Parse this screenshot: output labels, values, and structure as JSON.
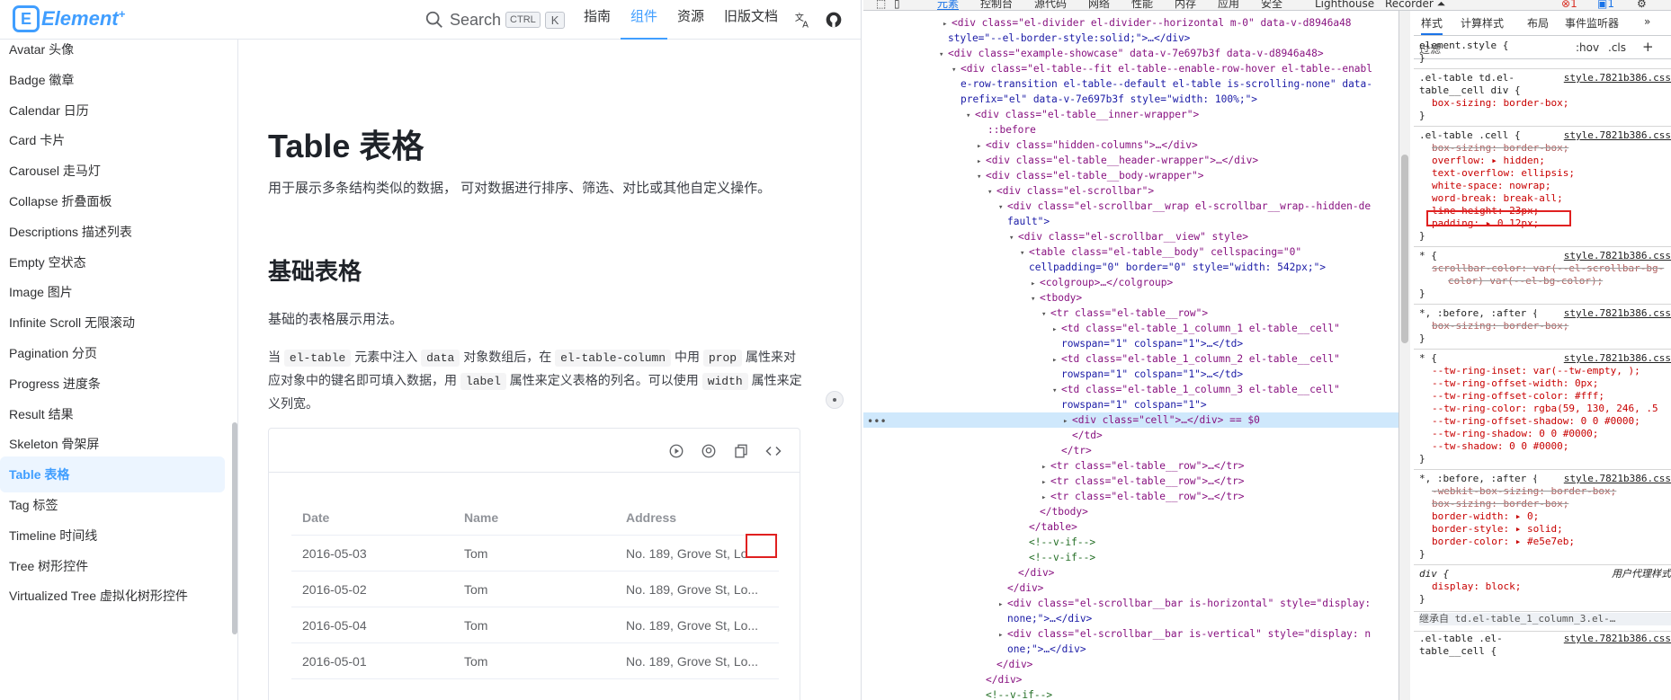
{
  "site": {
    "logo": "Element",
    "logo_plus": "+",
    "search": {
      "placeholder": "Search",
      "kbd_ctrl": "CTRL",
      "kbd_k": "K"
    },
    "nav": [
      "指南",
      "组件",
      "资源",
      "旧版文档"
    ],
    "sidebar": [
      "Avatar 头像",
      "Badge 徽章",
      "Calendar 日历",
      "Card 卡片",
      "Carousel 走马灯",
      "Collapse 折叠面板",
      "Descriptions 描述列表",
      "Empty 空状态",
      "Image 图片",
      "Infinite Scroll 无限滚动",
      "Pagination 分页",
      "Progress 进度条",
      "Result 结果",
      "Skeleton 骨架屏",
      "Table 表格",
      "Tag 标签",
      "Timeline 时间线",
      "Tree 树形控件",
      "Virtualized Tree   虚拟化树形控件"
    ],
    "title": "Table 表格",
    "description": "用于展示多条结构类似的数据， 可对数据进行排序、筛选、对比或其他自定义操作。",
    "section_title": "基础表格",
    "section_sub": "基础的表格展示用法。",
    "section_desc": {
      "p1": "当",
      "c1": "el-table",
      "p2": "元素中注入",
      "c2": "data",
      "p3": "对象数组后，在",
      "c3": "el-table-column",
      "p4": "中用",
      "c4": "prop",
      "p5": "属性来对应对象中的键名即可填入数据，用",
      "c5": "label",
      "p6": "属性来定义表格的列名。可以使用",
      "c6": "width",
      "p7": "属性来定义列宽。"
    },
    "table": {
      "headers": [
        "Date",
        "Name",
        "Address"
      ],
      "rows": [
        [
          "2016-05-03",
          "Tom",
          "No. 189, Grove St, Lo..."
        ],
        [
          "2016-05-02",
          "Tom",
          "No. 189, Grove St, Lo..."
        ],
        [
          "2016-05-04",
          "Tom",
          "No. 189, Grove St, Lo..."
        ],
        [
          "2016-05-01",
          "Tom",
          "No. 189, Grove St, Lo..."
        ]
      ]
    }
  },
  "devtools": {
    "tabs": [
      "元素",
      "控制台",
      "源代码",
      "网络",
      "性能",
      "内存",
      "应用",
      "安全",
      "Lighthouse",
      "Recorder ⏶"
    ],
    "badges": [
      "1",
      "1"
    ],
    "dom": [
      "<div class=\"el-divider el-divider--horizontal m-0\" data-v-d8946a48",
      "style=\"--el-border-style:solid;\">…</div>",
      "<div class=\"example-showcase\" data-v-7e697b3f data-v-d8946a48>",
      "<div class=\"el-table--fit el-table--enable-row-hover el-table--enabl",
      "e-row-transition el-table--default el-table is-scrolling-none\" data-",
      "prefix=\"el\" data-v-7e697b3f style=\"width: 100%;\">",
      "<div class=\"el-table__inner-wrapper\">",
      "::before",
      "<div class=\"hidden-columns\">…</div>",
      "<div class=\"el-table__header-wrapper\">…</div>",
      "<div class=\"el-table__body-wrapper\">",
      "<div class=\"el-scrollbar\">",
      "<div class=\"el-scrollbar__wrap el-scrollbar__wrap--hidden-de",
      "fault\">",
      "<div class=\"el-scrollbar__view\" style>",
      "<table class=\"el-table__body\" cellspacing=\"0\"",
      "cellpadding=\"0\" border=\"0\" style=\"width: 542px;\">",
      "<colgroup>…</colgroup>",
      "<tbody>",
      "<tr class=\"el-table__row\">",
      "<td class=\"el-table_1_column_1   el-table__cell\"",
      "rowspan=\"1\" colspan=\"1\">…</td>",
      "<td class=\"el-table_1_column_2   el-table__cell\"",
      "rowspan=\"1\" colspan=\"1\">…</td>",
      "<td class=\"el-table_1_column_3   el-table__cell\"",
      "rowspan=\"1\" colspan=\"1\">",
      "<div class=\"cell\">…</div> == $0",
      "</td>",
      "</tr>",
      "<tr class=\"el-table__row\">…</tr>",
      "<tr class=\"el-table__row\">…</tr>",
      "<tr class=\"el-table__row\">…</tr>",
      "</tbody>",
      "</table>",
      "<!--v-if-->",
      "<!--v-if-->",
      "</div>",
      "</div>",
      "<div class=\"el-scrollbar__bar is-horizontal\" style=\"display:",
      "none;\">…</div>",
      "<div class=\"el-scrollbar__bar is-vertical\" style=\"display: n",
      "one;\">…</div>",
      "</div>",
      "</div>",
      "<!--v-if-->"
    ],
    "styles": {
      "tabs": [
        "样式",
        "计算样式",
        "布局",
        "事件监听器",
        "»"
      ],
      "filter": "过滤",
      "hov": ":hov",
      "cls": ".cls",
      "lines": [
        "element.style {",
        "}",
        ".el-table td.el-",
        "table__cell div {",
        "box-sizing: border-box;",
        "}",
        ".el-table .cell {",
        "box-sizing: border-box;",
        "overflow: ▸ hidden;",
        "text-overflow: ellipsis;",
        "white-space: nowrap;",
        "word-break: break-all;",
        "line-height: 23px;",
        "padding: ▸ 0 12px;",
        "}",
        "* {",
        "scrollbar-color: var(--el-scrollbar-bg-",
        "color) var(--el-bg-color);",
        "}",
        "*, :before, :after {",
        "box-sizing: border-box;",
        "}",
        "* {",
        "--tw-ring-inset: var(--tw-empty, );",
        "--tw-ring-offset-width: 0px;",
        "--tw-ring-offset-color: #fff;",
        "--tw-ring-color: rgba(59, 130, 246, .5",
        "--tw-ring-offset-shadow: 0 0 #0000;",
        "--tw-ring-shadow: 0 0 #0000;",
        "--tw-shadow: 0 0 #0000;",
        "}",
        "*, :before, :after {",
        "-webkit-box-sizing: border-box;",
        "box-sizing: border-box;",
        "border-width: ▸ 0;",
        "border-style: ▸ solid;",
        "border-color: ▸ #e5e7eb;",
        "}",
        "div {",
        "display: block;",
        "}",
        "继承自 td.el-table_1_column_3.el-…",
        ".el-table .el-",
        "table__cell {"
      ],
      "source": "style.7821b386.css",
      "ua": "用户代理样式"
    }
  },
  "colors": {
    "accent": "#409eff",
    "highlight": "#e02020"
  }
}
